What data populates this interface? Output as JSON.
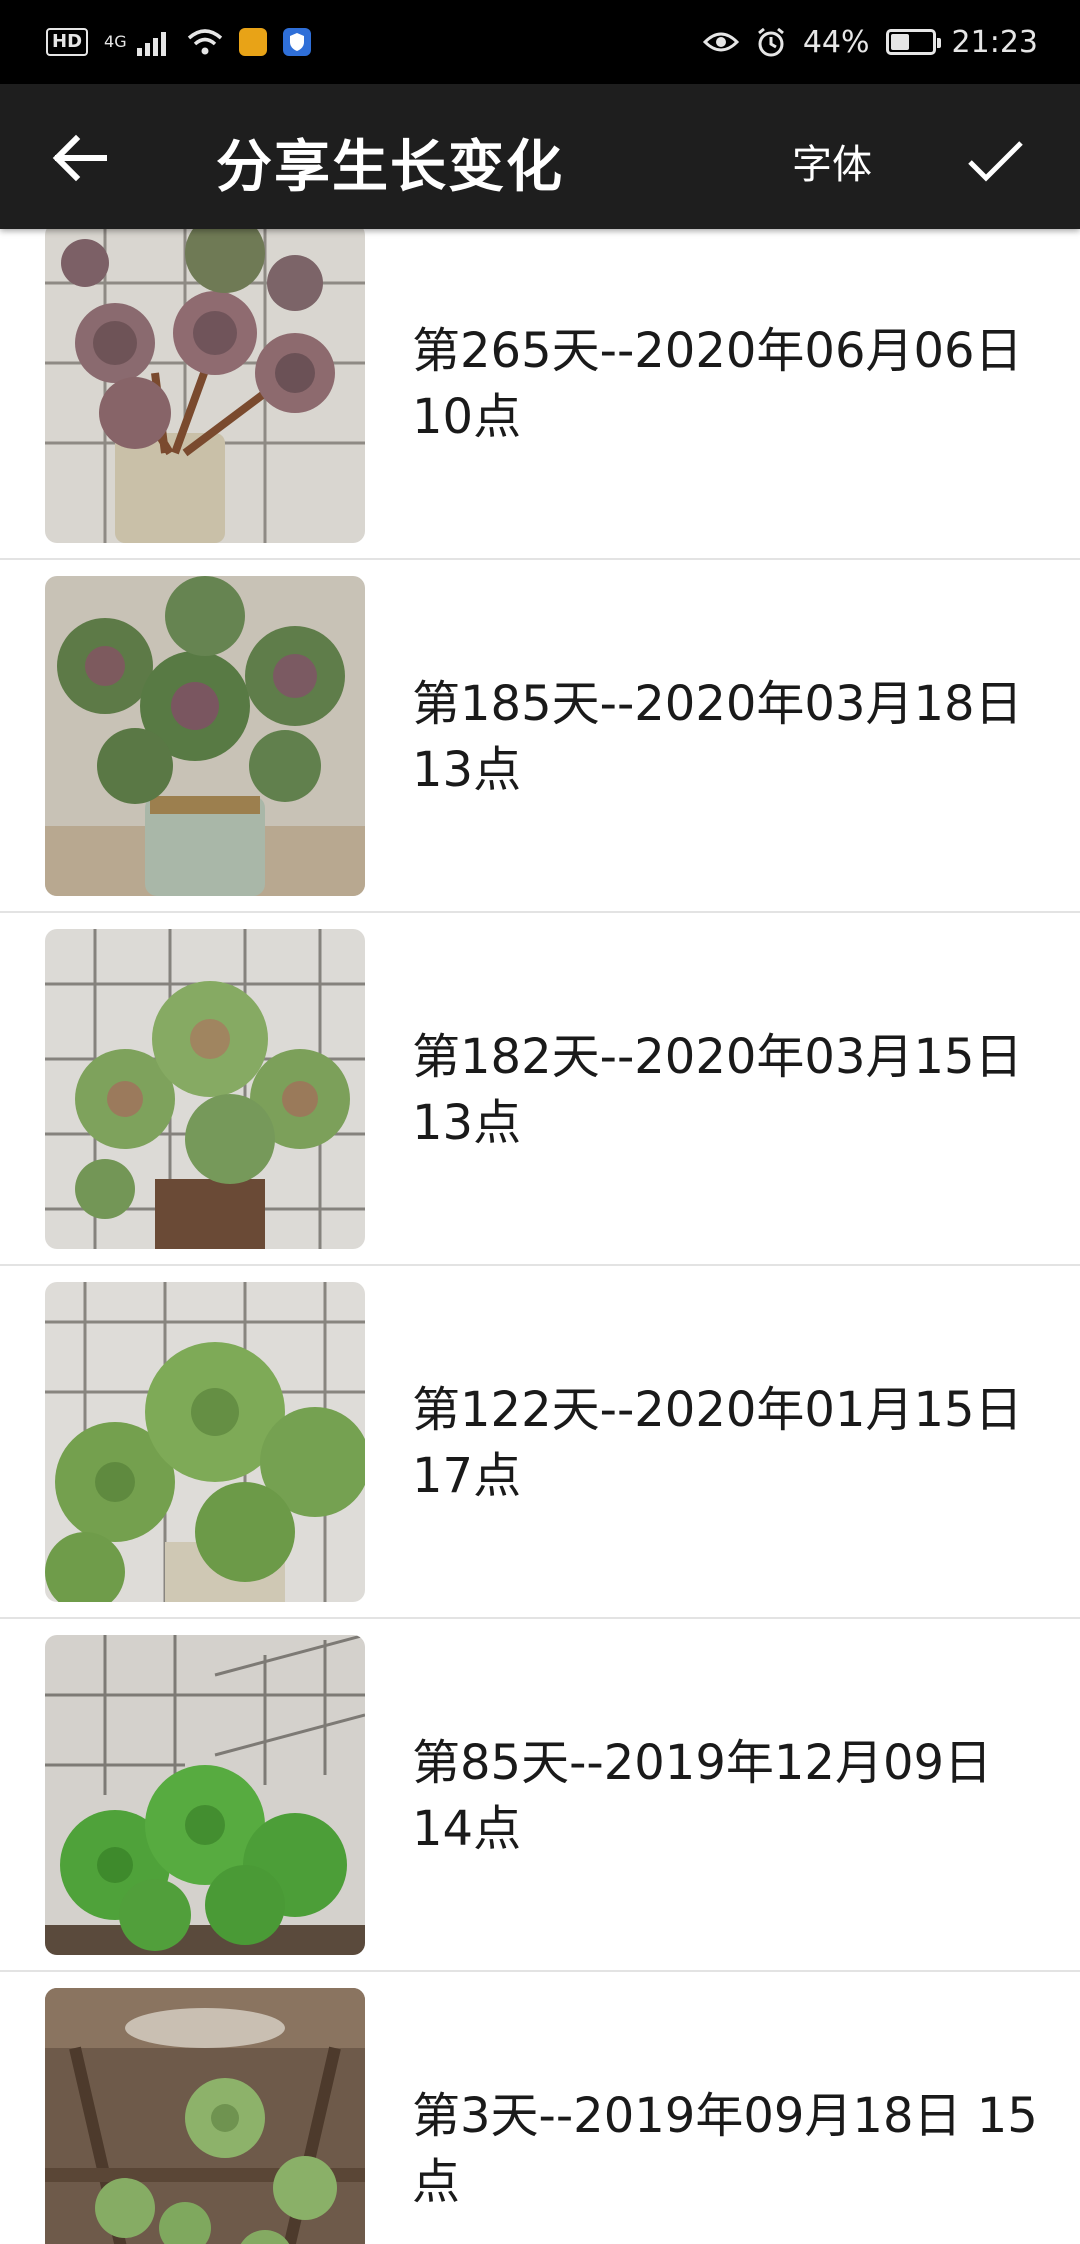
{
  "status_bar": {
    "network_label": "4G",
    "battery_percent": "44%",
    "battery_level": 0.44,
    "time": "21:23",
    "icons": [
      "hd-icon",
      "signal-icon",
      "wifi-icon",
      "app-notification-icon",
      "shield-app-icon",
      "eye-icon",
      "alarm-icon",
      "battery-icon"
    ]
  },
  "toolbar": {
    "title": "分享生长变化",
    "font_label": "字体",
    "back_icon": "arrow-left-icon",
    "confirm_icon": "checkmark-icon"
  },
  "entries": [
    {
      "line1": "第265天--2020年06月06日",
      "line2": "10点",
      "photo": "succulent-purple-rosettes"
    },
    {
      "line1": "第185天--2020年03月18日",
      "line2": "13点",
      "photo": "succulent-green-purple-cluster"
    },
    {
      "line1": "第182天--2020年03月15日",
      "line2": "13点",
      "photo": "succulent-green-rosettes-tiles"
    },
    {
      "line1": "第122天--2020年01月15日",
      "line2": "17点",
      "photo": "succulent-green-rosettes-pot"
    },
    {
      "line1": "第85天--2019年12月09日",
      "line2": "14点",
      "photo": "succulent-bright-green-cluster"
    },
    {
      "line1": "第3天--2019年09月18日 15",
      "line2": "点",
      "photo": "succulent-young-on-shelf"
    }
  ],
  "colors": {
    "status_bar_bg": "#000000",
    "toolbar_bg": "#1e1e1e",
    "divider": "#e3e3e3",
    "text": "#1a1a1a"
  }
}
